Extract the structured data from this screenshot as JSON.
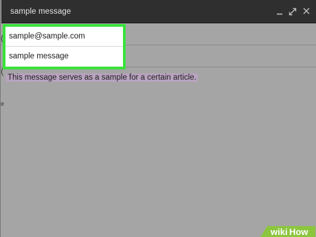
{
  "window": {
    "title": "sample message"
  },
  "fields": {
    "to_value": "sample@sample.com",
    "subject_value": "sample message"
  },
  "body": {
    "text": "This message serves as a sample for a certain article."
  },
  "colors": {
    "highlight": "#3be13d",
    "titlebar": "#2f2f2f",
    "text_selection": "#b9a3c0"
  },
  "icons": [
    "minimize-icon",
    "expand-icon",
    "close-icon"
  ],
  "watermark": {
    "text": "wikiHow"
  }
}
